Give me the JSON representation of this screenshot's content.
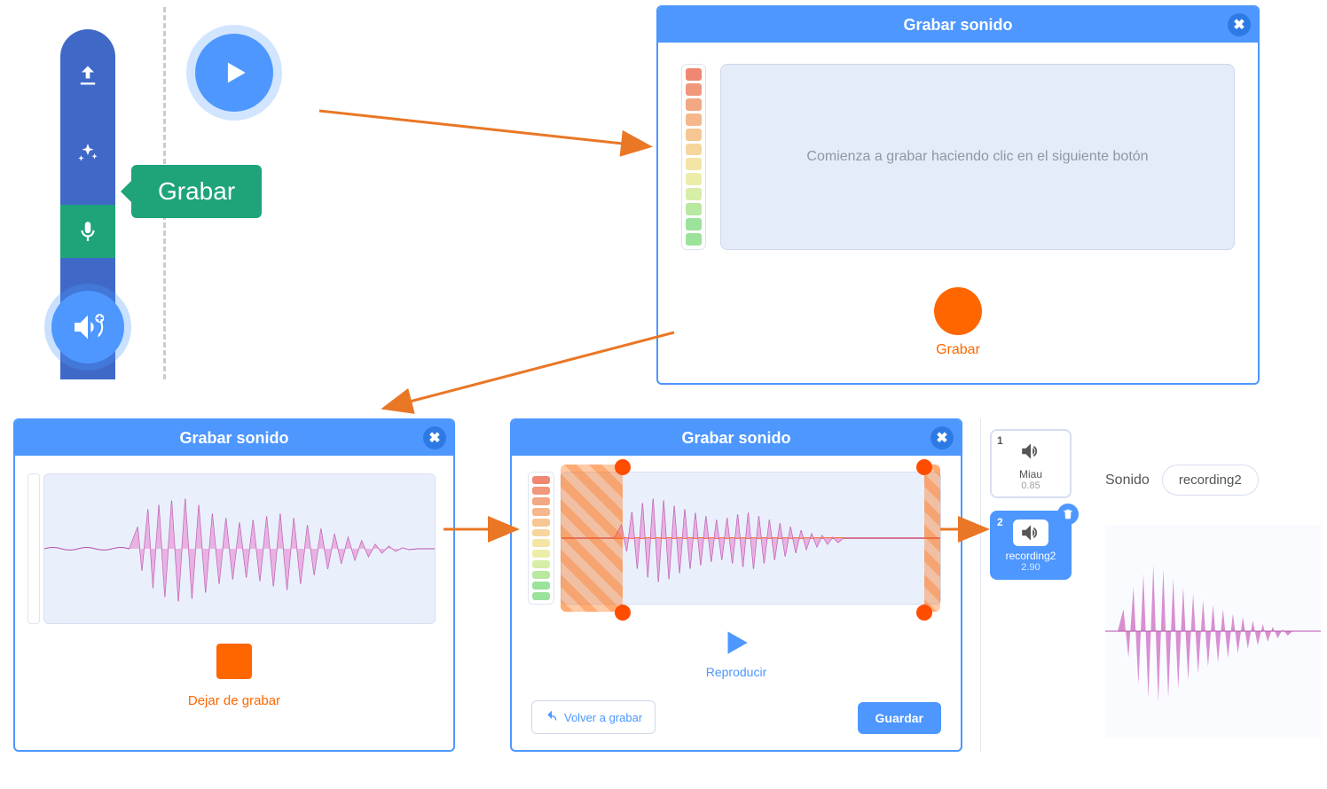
{
  "toolbar": {
    "upload_icon": "upload-icon",
    "sparkle_icon": "sparkle-icon",
    "record_icon": "microphone-icon",
    "search_icon": "magnify-icon",
    "record_tooltip": "Grabar",
    "add_sound_icon": "speaker-plus-icon"
  },
  "dialog1": {
    "title": "Grabar sonido",
    "placeholder": "Comienza a grabar haciendo clic en el siguiente botón",
    "record_label": "Grabar"
  },
  "dialog2": {
    "title": "Grabar sonido",
    "stop_label": "Dejar de grabar"
  },
  "dialog3": {
    "title": "Grabar sonido",
    "play_label": "Reproducir",
    "again_label": "Volver a grabar",
    "save_label": "Guardar"
  },
  "panel5": {
    "field_label": "Sonido",
    "field_value": "recording2",
    "sounds": [
      {
        "index": "1",
        "name": "Miau",
        "duration": "0.85",
        "selected": false
      },
      {
        "index": "2",
        "name": "recording2",
        "duration": "2.90",
        "selected": true
      }
    ]
  },
  "colors": {
    "accent": "#4d97ff",
    "record": "#ff6600",
    "green": "#1fa37a",
    "wave": "#cf6fc4"
  }
}
